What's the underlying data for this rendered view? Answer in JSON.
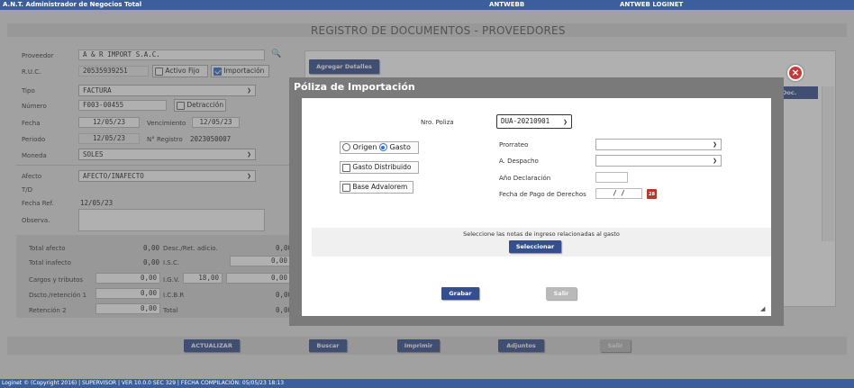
{
  "topbar": {
    "app_title": "A.N.T. Administrador de Negocios Total",
    "link1": "ANTWEBB",
    "link2": "ANTWEB LOGINET"
  },
  "page_title": "REGISTRO DE DOCUMENTOS - PROVEEDORES",
  "form": {
    "proveedor_label": "Proveedor",
    "proveedor_value": "A & R IMPORT S.A.C.",
    "ruc_label": "R.U.C.",
    "ruc_value": "20535939251",
    "activo_fijo_label": "Activo Fijo",
    "importacion_label": "Importación",
    "tipo_label": "Tipo",
    "tipo_value": "FACTURA",
    "numero_label": "Número",
    "numero_value": "F003-00455",
    "detraccion_label": "Detracción",
    "fecha_label": "Fecha",
    "fecha_value": "12/05/23",
    "vencimiento_label": "Vencimiento",
    "vencimiento_value": "12/05/23",
    "periodo_label": "Periodo",
    "periodo_value": "12/05/23",
    "nregistro_label": "N° Registro",
    "nregistro_value": "2023050007",
    "moneda_label": "Moneda",
    "moneda_value": "SOLES",
    "afecto_label": "Afecto",
    "afecto_value": "AFECTO/INAFECTO",
    "td_label": "T/D",
    "fecharef_label": "Fecha Ref.",
    "fecharef_value": "12/05/23",
    "observa_label": "Observa."
  },
  "totals": {
    "total_afecto_label": "Total afecto",
    "total_afecto_value": "0,00",
    "total_inafecto_label": "Total inafecto",
    "total_inafecto_value": "0,00",
    "cargos_label": "Cargos y tributos",
    "cargos_value": "0,00",
    "dscto_label": "Dscto./retención 1",
    "dscto_value": "0,00",
    "retencion2_label": "Retención 2",
    "retencion2_value": "0,00",
    "desc_ret_label": "Desc./Ret. adicio.",
    "desc_ret_value": "0,00",
    "isc_label": "I.S.C.",
    "isc_value": "0,00",
    "igv_label": "I.G.V.",
    "igv_rate": "18,00",
    "igv_value": "0,00",
    "icbr_label": "I.C.B.R",
    "icbr_value": "0,00",
    "total_label": "Total",
    "total_value": "0,00"
  },
  "panel": {
    "agregar_detalles": "Agregar Detalles",
    "doc_header": "Doc."
  },
  "bottom": {
    "actualizar": "ACTUALIZAR",
    "buscar": "Buscar",
    "imprimir": "Imprimir",
    "adjuntos": "Adjuntos",
    "salir": "Salir"
  },
  "footer": "Loginet © (Copyright 2016) | SUPERVISOR | VER 10.0.0 SEC 329 | FECHA COMPILACIÓN: 05/05/23 18:13",
  "modal": {
    "title": "Póliza de Importación",
    "close_symbol": "×",
    "nro_poliza_label": "Nro. Poliza",
    "nro_poliza_value": "DUA-20210901",
    "origen_label": "Origen",
    "gasto_label": "Gasto",
    "gasto_distribuido_label": "Gasto Distribuido",
    "base_advalorem_label": "Base Advalorem",
    "prorrateo_label": "Prorrateo",
    "despacho_label": "A. Despacho",
    "anio_label": "Año Declaración",
    "fecha_pago_label": "Fecha de Pago de Derechos",
    "fecha_pago_value": "/ /",
    "seleccione_text": "Seleccione las notas de ingreso relacionadas al gasto",
    "seleccionar": "Seleccionar",
    "grabar": "Grabar",
    "salir": "Salir"
  }
}
